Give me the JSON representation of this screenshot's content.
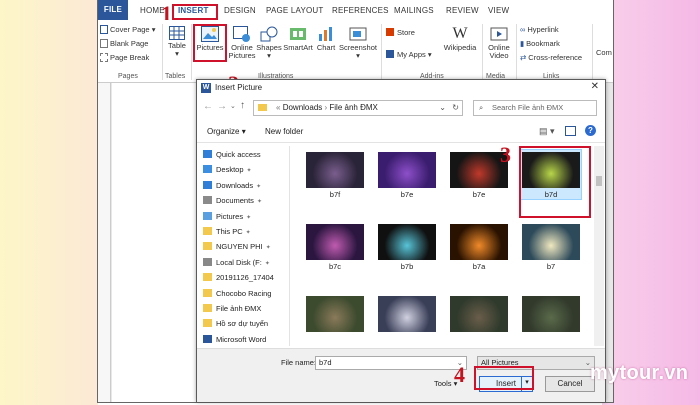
{
  "ribbon": {
    "tabs": [
      "FILE",
      "HOME",
      "INSERT",
      "DESIGN",
      "PAGE LAYOUT",
      "REFERENCES",
      "MAILINGS",
      "REVIEW",
      "VIEW"
    ],
    "pages_group": {
      "items": [
        "Cover Page",
        "Blank Page",
        "Page Break"
      ],
      "label": "Pages"
    },
    "tables_group": {
      "item": "Table",
      "label": "Tables"
    },
    "illustrations_group": {
      "items": [
        "Pictures",
        "Online Pictures",
        "Shapes",
        "SmartArt",
        "Chart",
        "Screenshot"
      ],
      "label": "Illustrations"
    },
    "addins_group": {
      "items": [
        "Store",
        "My Apps",
        "Wikipedia"
      ],
      "label": "Add-ins"
    },
    "media_group": {
      "item": "Online Video",
      "label": "Media"
    },
    "links_group": {
      "items": [
        "Hyperlink",
        "Bookmark",
        "Cross-reference"
      ],
      "label": "Links"
    },
    "extra": "Com"
  },
  "dialog": {
    "title": "Insert Picture",
    "address": {
      "crumbs": [
        "Downloads",
        "File ảnh ĐMX"
      ]
    },
    "search_placeholder": "Search File ảnh ĐMX",
    "toolbar": {
      "organize": "Organize",
      "new_folder": "New folder"
    },
    "nav": [
      {
        "label": "Quick access",
        "icon": "star-icon",
        "color": "#2f7fd8"
      },
      {
        "label": "Desktop",
        "icon": "folder-icon",
        "color": "#3c8fe0",
        "pinned": true
      },
      {
        "label": "Downloads",
        "icon": "download-icon",
        "color": "#2f7fd8",
        "pinned": true
      },
      {
        "label": "Documents",
        "icon": "document-icon",
        "color": "#8a8a8a",
        "pinned": true
      },
      {
        "label": "Pictures",
        "icon": "picture-icon",
        "color": "#5aa0e0",
        "pinned": true
      },
      {
        "label": "This PC",
        "icon": "folder-icon",
        "color": "#f2c94c",
        "pinned": true
      },
      {
        "label": "NGUYEN PHI",
        "icon": "folder-icon",
        "color": "#f2c94c",
        "pinned": true
      },
      {
        "label": "Local Disk (F:",
        "icon": "drive-icon",
        "color": "#888888",
        "pinned": true
      },
      {
        "label": "20191126_17404",
        "icon": "folder-icon",
        "color": "#f2c94c"
      },
      {
        "label": "Chocobo Racing",
        "icon": "folder-icon",
        "color": "#f2c94c"
      },
      {
        "label": "File ảnh ĐMX",
        "icon": "folder-icon",
        "color": "#f2c94c"
      },
      {
        "label": "Hồ sơ dự tuyển",
        "icon": "folder-icon",
        "color": "#f2c94c"
      },
      {
        "label": "Microsoft Word",
        "icon": "word-icon",
        "color": "#2b579a"
      }
    ],
    "thumbs": [
      {
        "label": "b7f",
        "c1": "#2a2438",
        "c2": "#7a5e8e"
      },
      {
        "label": "b7e",
        "c1": "#3a1d6e",
        "c2": "#8d4fc9"
      },
      {
        "label": "b7e",
        "c1": "#151515",
        "c2": "#c0392b"
      },
      {
        "label": "b7d",
        "c1": "#1a1a1a",
        "c2": "#b8d64a",
        "selected": true
      },
      {
        "label": "b7c",
        "c1": "#2b1640",
        "c2": "#c05bb0"
      },
      {
        "label": "b7b",
        "c1": "#101010",
        "c2": "#58c4d8"
      },
      {
        "label": "b7a",
        "c1": "#2a1200",
        "c2": "#f08a2a"
      },
      {
        "label": "b7",
        "c1": "#2d4a5a",
        "c2": "#f0e8c0"
      },
      {
        "label": "",
        "c1": "#3c4a2e",
        "c2": "#8a7a5a"
      },
      {
        "label": "",
        "c1": "#3a3f58",
        "c2": "#d0d0e0"
      },
      {
        "label": "",
        "c1": "#2f3a2c",
        "c2": "#6a5d4a"
      },
      {
        "label": "",
        "c1": "#323a2c",
        "c2": "#5a6a4a"
      }
    ],
    "file_name_label": "File name:",
    "file_name_value": "b7d",
    "filter_value": "All Pictures",
    "tools_label": "Tools",
    "insert_label": "Insert",
    "cancel_label": "Cancel"
  },
  "steps": [
    "1",
    "2",
    "3",
    "4"
  ],
  "watermark": "mytour.vn",
  "colors": {
    "accent": "#2b579a",
    "highlight": "#d0112b",
    "selection": "#cce8ff"
  }
}
